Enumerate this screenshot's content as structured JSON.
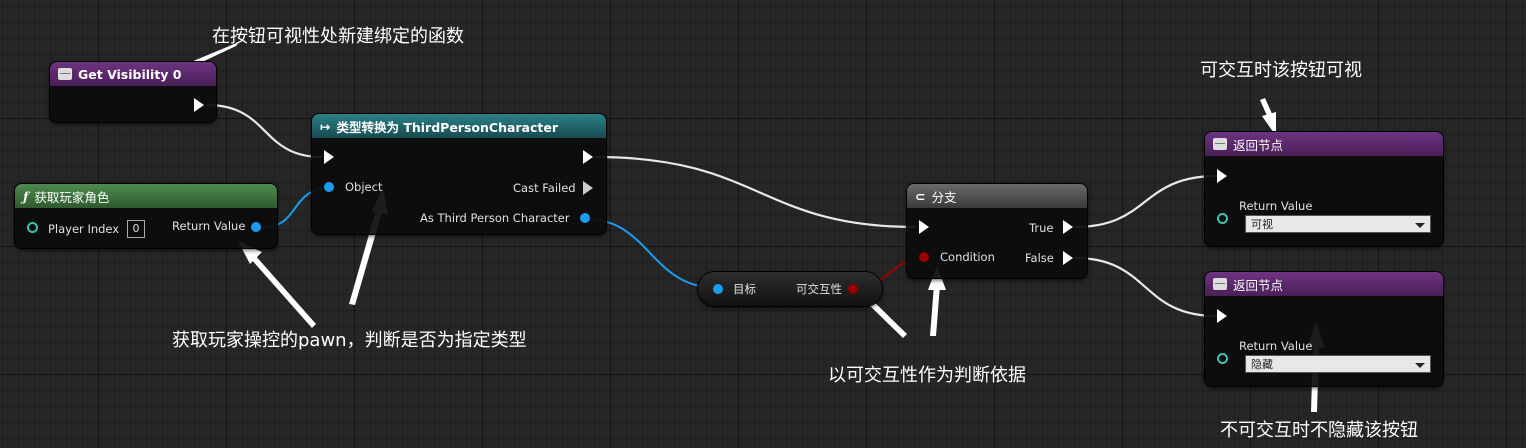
{
  "nodes": {
    "get_visibility": {
      "title": "Get Visibility 0"
    },
    "get_player": {
      "icon": "function-icon",
      "title": "获取玩家角色",
      "player_index_label": "Player Index",
      "player_index_value": "0",
      "return_label": "Return Value"
    },
    "cast": {
      "title": "类型转换为 ThirdPersonCharacter",
      "object_label": "Object",
      "cast_failed_label": "Cast Failed",
      "as_label": "As Third Person Character"
    },
    "interactive": {
      "target_label": "目标",
      "value_label": "可交互性"
    },
    "branch": {
      "title": "分支",
      "condition_label": "Condition",
      "true_label": "True",
      "false_label": "False"
    },
    "return_visible": {
      "title": "返回节点",
      "return_label": "Return Value",
      "value": "可视"
    },
    "return_hidden": {
      "title": "返回节点",
      "return_label": "Return Value",
      "value": "隐藏"
    }
  },
  "annotations": {
    "a1": "在按钮可视性处新建绑定的函数",
    "a2": "获取玩家操控的pawn，判断是否为指定类型",
    "a3": "以可交互性作为判断依据",
    "a4": "可交互时该按钮可视",
    "a5": "不可交互时不隐藏该按钮"
  },
  "colors": {
    "function_header": "#5e2b6e",
    "cast_header": "#1f5a60",
    "pure_header": "#3c6a3c",
    "branch_header": "#5a5a5a",
    "object_pin": "#1a9cf0",
    "bool_pin": "#9a0000"
  }
}
